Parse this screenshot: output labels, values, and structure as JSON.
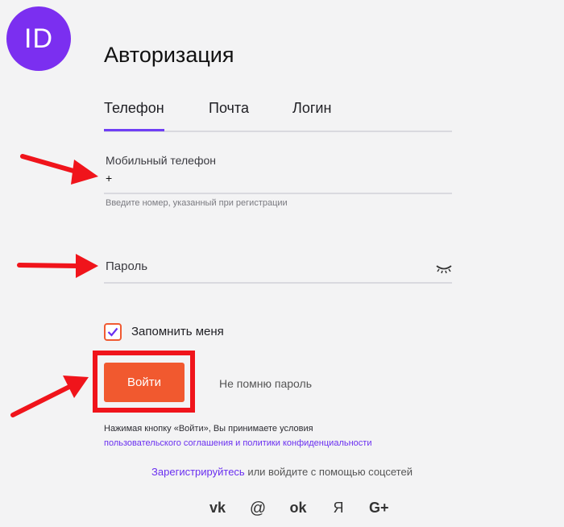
{
  "logo": {
    "text": "ID"
  },
  "title": "Авторизация",
  "tabs": [
    {
      "label": "Телефон",
      "active": true
    },
    {
      "label": "Почта",
      "active": false
    },
    {
      "label": "Логин",
      "active": false
    }
  ],
  "phone": {
    "label": "Мобильный телефон",
    "value": "+",
    "hint": "Введите номер, указанный при регистрации"
  },
  "password": {
    "placeholder": "Пароль"
  },
  "remember": {
    "label": "Запомнить меня",
    "checked": true
  },
  "login_button": "Войти",
  "forgot_link": "Не помню пароль",
  "terms": {
    "line1": "Нажимая кнопку «Войти», Вы принимаете условия",
    "link": "пользовательского соглашения и политики конфиденциальности"
  },
  "register": {
    "link": "Зарегистрируйтесь",
    "rest": "или войдите с помощью соцсетей"
  },
  "socials": [
    "vk",
    "@",
    "ok",
    "Я",
    "G+"
  ],
  "colors": {
    "accent": "#6f3ff5",
    "button": "#f1592f",
    "annotation": "#f0141b",
    "logo": "#7b2ff0"
  }
}
